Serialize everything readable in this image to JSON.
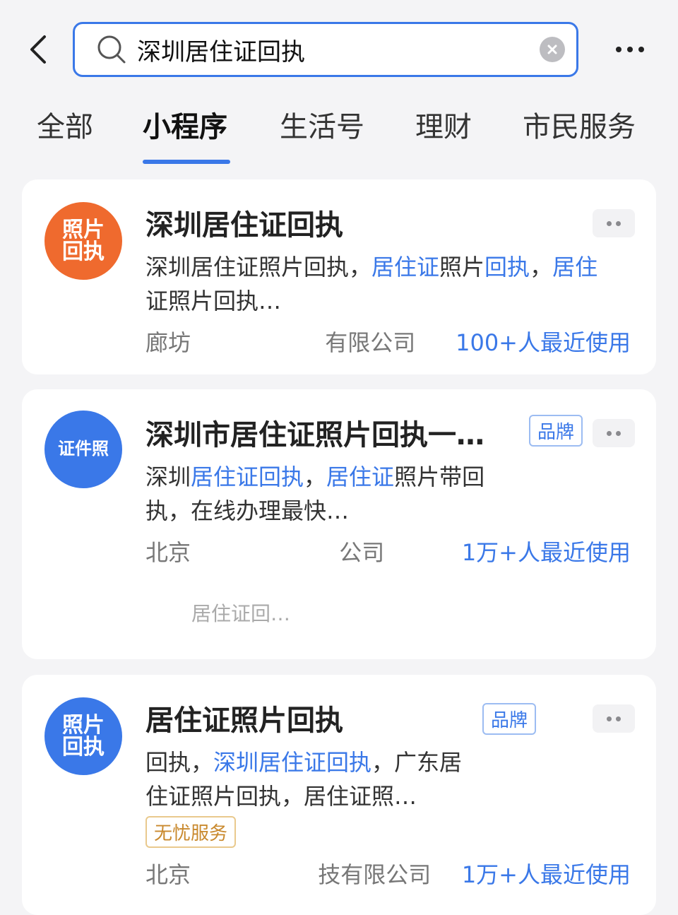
{
  "search": {
    "query": "深圳居住证回执"
  },
  "tabs": [
    {
      "label": "全部"
    },
    {
      "label": "小程序"
    },
    {
      "label": "生活号"
    },
    {
      "label": "理财"
    },
    {
      "label": "市民服务"
    }
  ],
  "colors": {
    "accent": "#3a78e8",
    "logo_orange": "#ef6a2e",
    "logo_blue": "#3a78e8",
    "badge_gold": "#c9892d"
  },
  "cards": [
    {
      "logo_line1": "照片",
      "logo_line2": "回执",
      "title": "深圳居住证回执",
      "desc_pre": "深圳居住证照片回执，",
      "desc_hl1": "居住证",
      "desc_mid": "照片",
      "desc_hl2": "回执",
      "desc_sep": "，",
      "desc_hl3": "居住",
      "desc_line2": "证照片回执…",
      "company": "廊坊",
      "company_tail": "有限公司",
      "usage": "100+人最近使用"
    },
    {
      "logo_text": "证件照",
      "title": "深圳市居住证照片回执一…",
      "badge": "品牌",
      "desc_pre": "深圳",
      "desc_hl1": "居住证回执",
      "desc_sep": "，",
      "desc_hl2": "居住证",
      "desc_mid": "照片带回",
      "desc_line2": "执，在线办理最快…",
      "company": "北京",
      "company_tail": "公司",
      "usage": "1万+人最近使用",
      "sub_link": "居住证回…"
    },
    {
      "logo_line1": "照片",
      "logo_line2": "回执",
      "title": "居住证照片回执",
      "badge": "品牌",
      "desc_pre": "回执，",
      "desc_hl1": "深圳居住证回执",
      "desc_sep": "，",
      "desc_mid": "广东居",
      "desc_line2": "住证照片回执，居住证照…",
      "tag": "无忧服务",
      "company": "北京",
      "company_tail": "技有限公司",
      "usage": "1万+人最近使用"
    }
  ]
}
